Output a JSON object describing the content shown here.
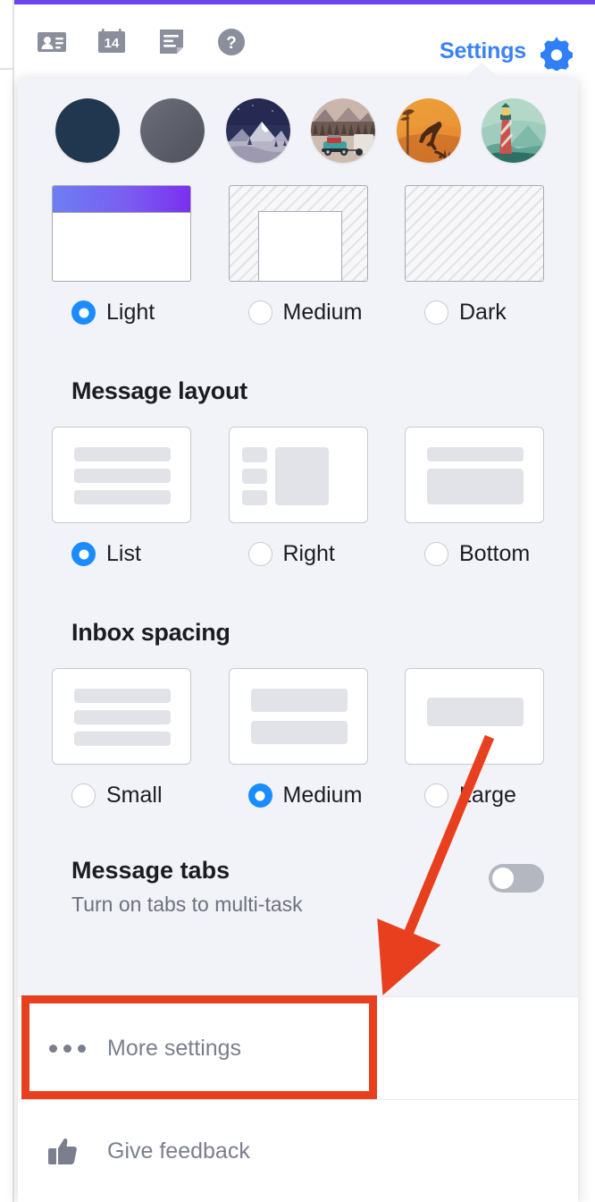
{
  "window": {
    "accent_purple": "#6a46f0",
    "panel_bg": "#f2f3f9"
  },
  "header": {
    "icons": [
      {
        "name": "contact-card-icon",
        "label": "Contacts"
      },
      {
        "name": "calendar-icon",
        "label": "Calendar",
        "day": "14"
      },
      {
        "name": "notes-icon",
        "label": "Notes"
      },
      {
        "name": "help-icon",
        "label": "Help"
      }
    ],
    "settings_label": "Settings",
    "settings_color": "#3b82f6",
    "gear_icon": "gear-icon"
  },
  "panel": {
    "themes": [
      {
        "name": "theme-dark-navy",
        "kind": "solid",
        "color": "#21364f"
      },
      {
        "name": "theme-grey",
        "kind": "solid",
        "color": "#5a5d67"
      },
      {
        "name": "theme-mountain-night",
        "kind": "image"
      },
      {
        "name": "theme-road-trip",
        "kind": "image"
      },
      {
        "name": "theme-kangaroo-sunset",
        "kind": "image"
      },
      {
        "name": "theme-lighthouse",
        "kind": "image"
      }
    ],
    "appearance": {
      "options": [
        {
          "label": "Light",
          "selected": true,
          "preview": "light"
        },
        {
          "label": "Medium",
          "selected": false,
          "preview": "medium"
        },
        {
          "label": "Dark",
          "selected": false,
          "preview": "dark"
        }
      ]
    },
    "message_layout": {
      "title": "Message layout",
      "options": [
        {
          "label": "List",
          "selected": true,
          "preview": "list"
        },
        {
          "label": "Right",
          "selected": false,
          "preview": "right"
        },
        {
          "label": "Bottom",
          "selected": false,
          "preview": "bottom"
        }
      ]
    },
    "inbox_spacing": {
      "title": "Inbox spacing",
      "options": [
        {
          "label": "Small",
          "selected": false,
          "preview": "small"
        },
        {
          "label": "Medium",
          "selected": true,
          "preview": "medium"
        },
        {
          "label": "Large",
          "selected": false,
          "preview": "large"
        }
      ]
    },
    "message_tabs": {
      "title": "Message tabs",
      "subtitle": "Turn on tabs to multi-task",
      "enabled": false
    },
    "footer": [
      {
        "name": "more-settings",
        "icon": "ellipsis-icon",
        "label": "More settings"
      },
      {
        "name": "give-feedback",
        "icon": "thumbs-up-icon",
        "label": "Give feedback"
      }
    ]
  },
  "annotations": {
    "highlight_color": "#e8401f",
    "box_target": "More settings",
    "arrow_target": "More settings"
  }
}
